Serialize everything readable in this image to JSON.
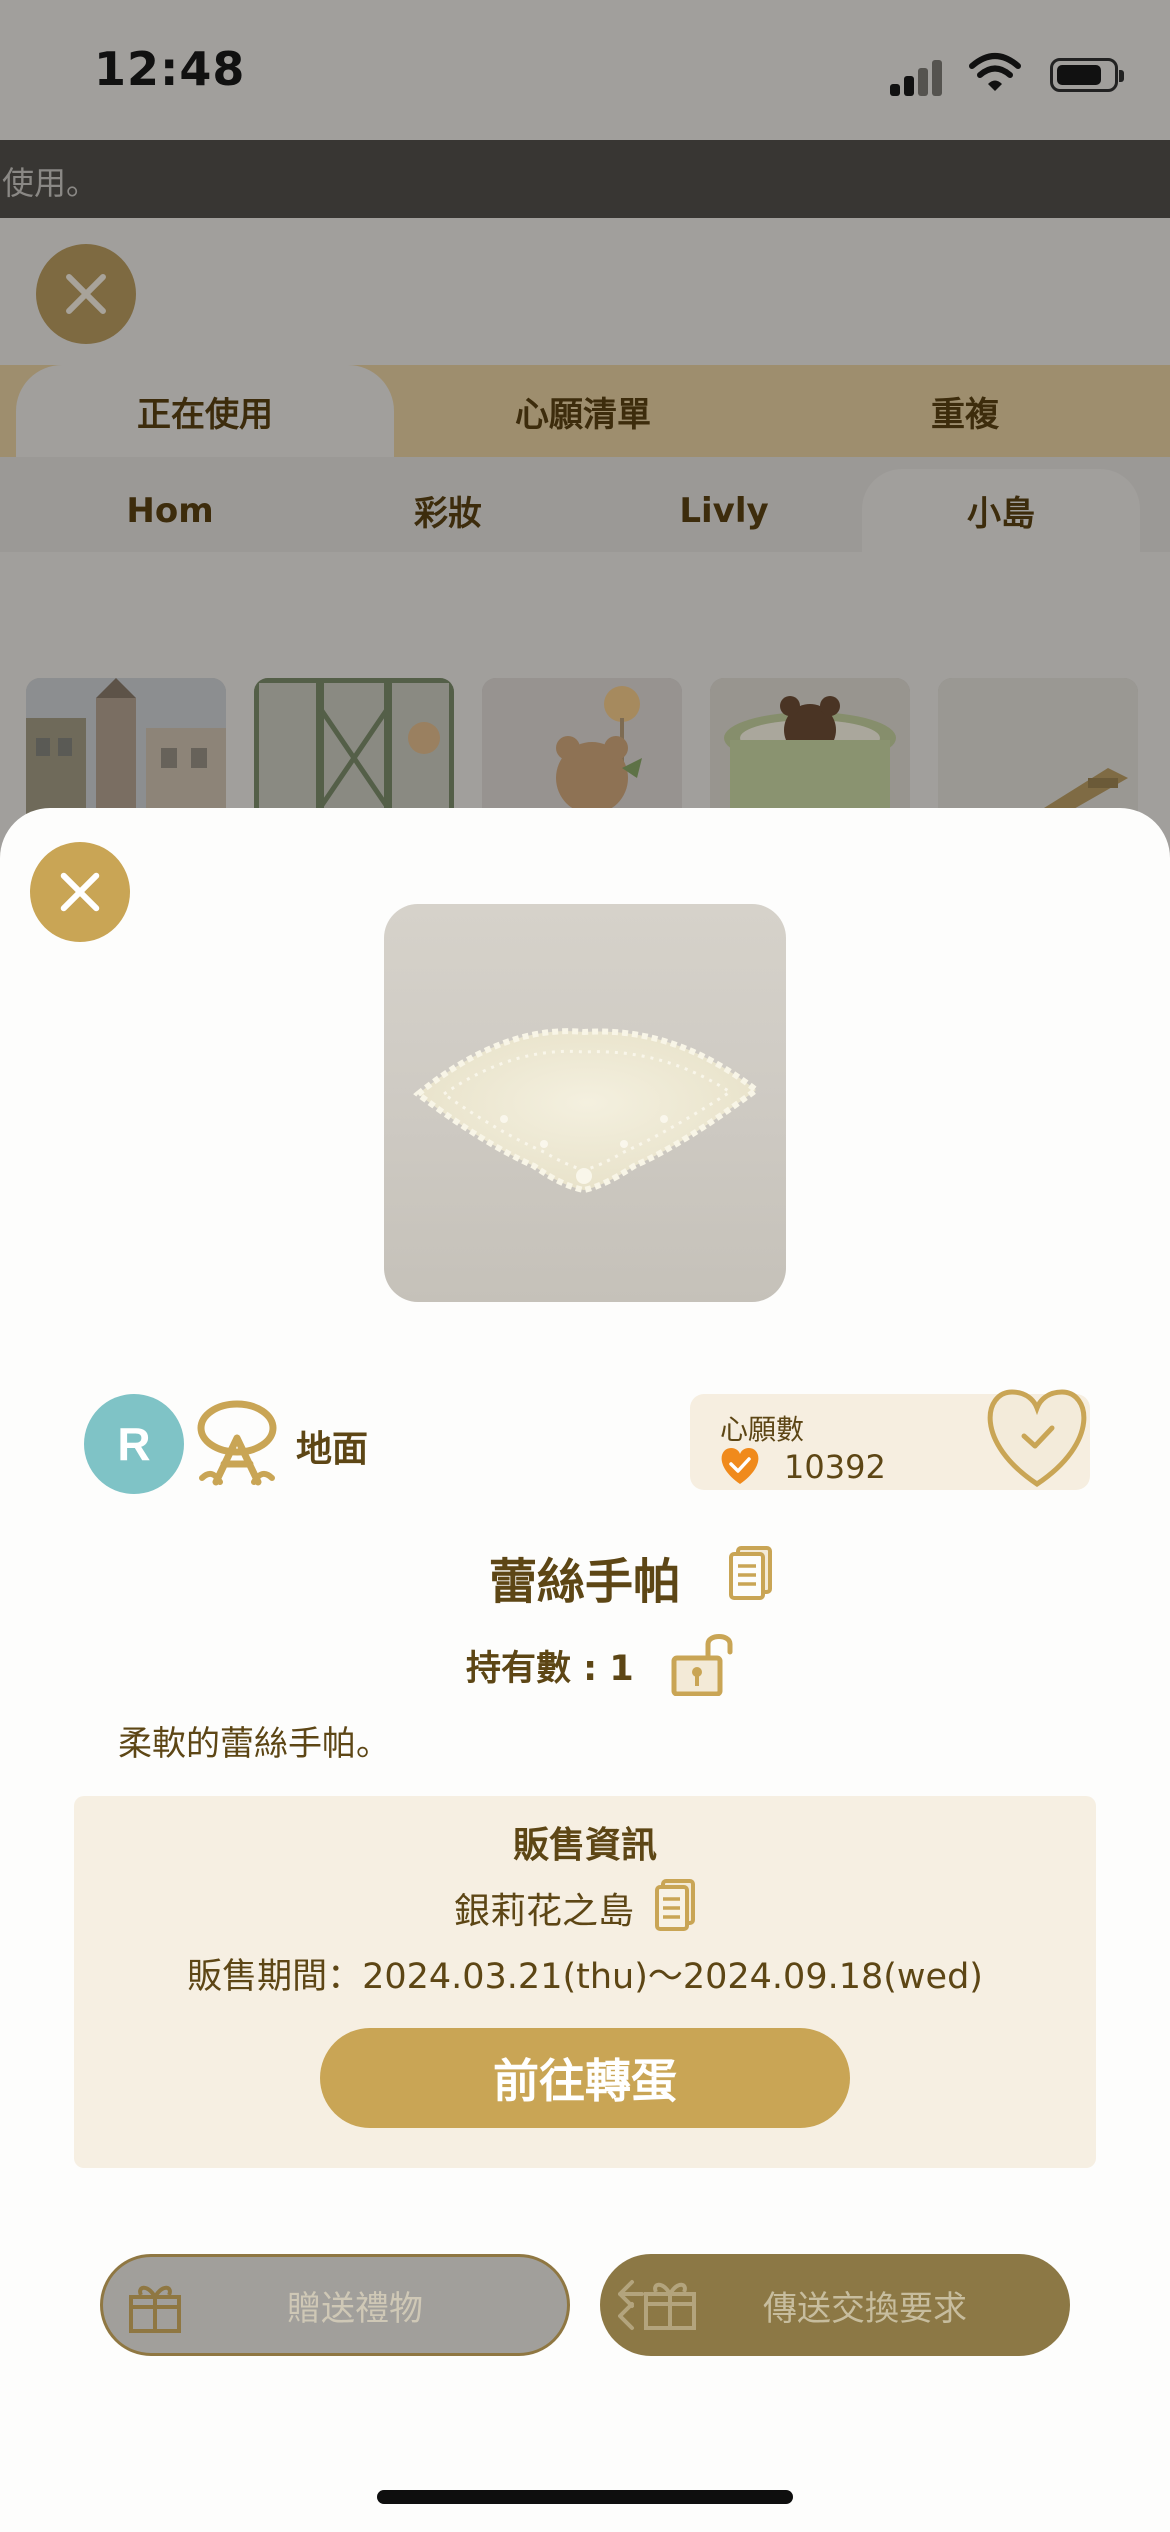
{
  "status_bar": {
    "time": "12:48"
  },
  "notice": {
    "text": "使用。"
  },
  "tabs_primary": [
    {
      "label": "正在使用",
      "active": true
    },
    {
      "label": "心願清單",
      "active": false
    },
    {
      "label": "重複",
      "active": false
    }
  ],
  "tabs_secondary": [
    {
      "label": "Hom",
      "active": false
    },
    {
      "label": "彩妝",
      "active": false
    },
    {
      "label": "Livly",
      "active": false
    },
    {
      "label": "小島",
      "active": true
    }
  ],
  "item": {
    "rarity": "R",
    "category": "地面",
    "category_icon": "floor-category-icon",
    "name": "蕾絲手帕",
    "owned_label": "持有數 : 1",
    "description": "柔軟的蕾絲手帕。"
  },
  "wish": {
    "label": "心願數",
    "count": "10392"
  },
  "sale": {
    "title": "販售資訊",
    "island": "銀莉花之島",
    "period": "販售期間：2024.03.21(thu)～2024.09.18(wed)",
    "button": "前往轉蛋"
  },
  "actions": {
    "gift": "贈送禮物",
    "trade": "傳送交換要求"
  },
  "colors": {
    "accent_gold": "#c9a555",
    "text_brown": "#5d4615",
    "rarity_teal": "#7fc3c6",
    "panel_cream": "#f6efe2",
    "heart_orange": "#f08a1c"
  }
}
